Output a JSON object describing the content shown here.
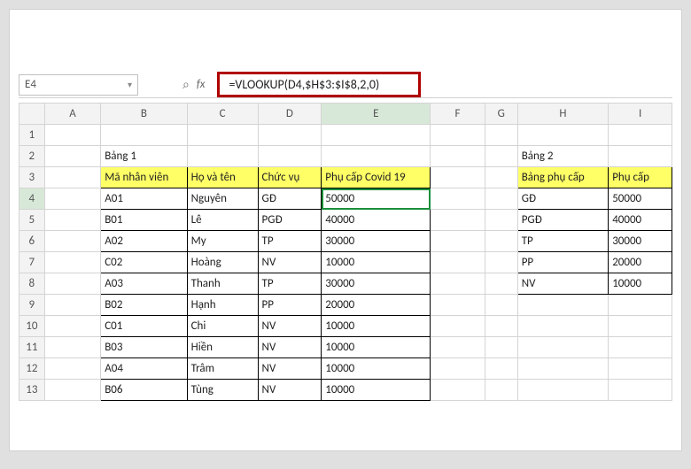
{
  "name_box": "E4",
  "formula": "=VLOOKUP(D4,$H$3:$I$8,2,0)",
  "columns": [
    "A",
    "B",
    "C",
    "D",
    "E",
    "F",
    "G",
    "H",
    "I"
  ],
  "row_count": 13,
  "selected": {
    "col": "E",
    "row": 4
  },
  "labels": {
    "bang1": "Bảng 1",
    "bang2": "Bảng 2"
  },
  "table1": {
    "headers": [
      "Mã nhân viên",
      "Họ và tên",
      "Chức vụ",
      "Phụ cấp Covid 19"
    ],
    "rows": [
      [
        "A01",
        "Nguyên",
        "GĐ",
        "50000"
      ],
      [
        "B01",
        "Lê",
        "PGĐ",
        "40000"
      ],
      [
        "A02",
        "My",
        "TP",
        "30000"
      ],
      [
        "C02",
        "Hoàng",
        "NV",
        "10000"
      ],
      [
        "A03",
        "Thanh",
        "TP",
        "30000"
      ],
      [
        "B02",
        "Hạnh",
        "PP",
        "20000"
      ],
      [
        "C01",
        "Chi",
        "NV",
        "10000"
      ],
      [
        "B03",
        "Hiền",
        "NV",
        "10000"
      ],
      [
        "A04",
        "Trâm",
        "NV",
        "10000"
      ],
      [
        "B06",
        "Tùng",
        "NV",
        "10000"
      ]
    ]
  },
  "table2": {
    "headers": [
      "Bảng phụ cấp",
      "Phụ cấp"
    ],
    "rows": [
      [
        "GĐ",
        "50000"
      ],
      [
        "PGĐ",
        "40000"
      ],
      [
        "TP",
        "30000"
      ],
      [
        "PP",
        "20000"
      ],
      [
        "NV",
        "10000"
      ]
    ]
  }
}
